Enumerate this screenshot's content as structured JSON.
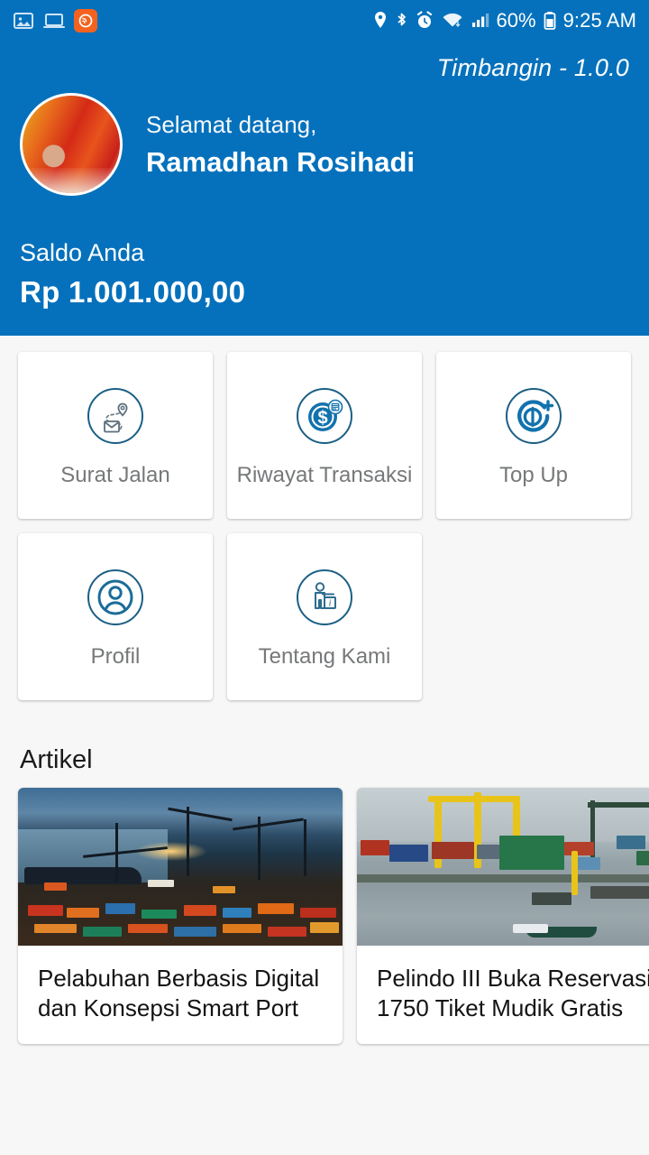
{
  "statusbar": {
    "left_icons": [
      "image-icon",
      "screenshot-icon",
      "app-badge-icon"
    ],
    "right_icons": [
      "location-icon",
      "bluetooth-icon",
      "alarm-icon",
      "wifi-icon",
      "signal-icon"
    ],
    "battery_percent": "60%",
    "battery_icon": "battery-icon",
    "time": "9:25 AM"
  },
  "header": {
    "version": "Timbangin - 1.0.0",
    "avatar": "user-avatar",
    "greeting": "Selamat datang,",
    "username": "Ramadhan Rosihadi",
    "balance_label": "Saldo Anda",
    "balance_amount": "Rp 1.001.000,00",
    "background_color": "#0571bc"
  },
  "menu": {
    "items": [
      {
        "label": "Surat Jalan",
        "icon": "route-mail-icon"
      },
      {
        "label": "Riwayat Transaksi",
        "icon": "transaction-history-icon"
      },
      {
        "label": "Top Up",
        "icon": "top-up-icon"
      },
      {
        "label": "Profil",
        "icon": "profile-icon"
      },
      {
        "label": "Tentang Kami",
        "icon": "about-us-icon"
      }
    ],
    "accent_color": "#1272ad",
    "label_color": "#76787a"
  },
  "articles": {
    "section_title": "Artikel",
    "items": [
      {
        "title": "Pelabuhan Berbasis Digital dan Konsepsi Smart Port",
        "image": "container-port-dusk-photo"
      },
      {
        "title": "Pelindo III Buka Reservasi 1750 Tiket Mudik Gratis",
        "image": "container-port-daytime-photo"
      }
    ]
  }
}
